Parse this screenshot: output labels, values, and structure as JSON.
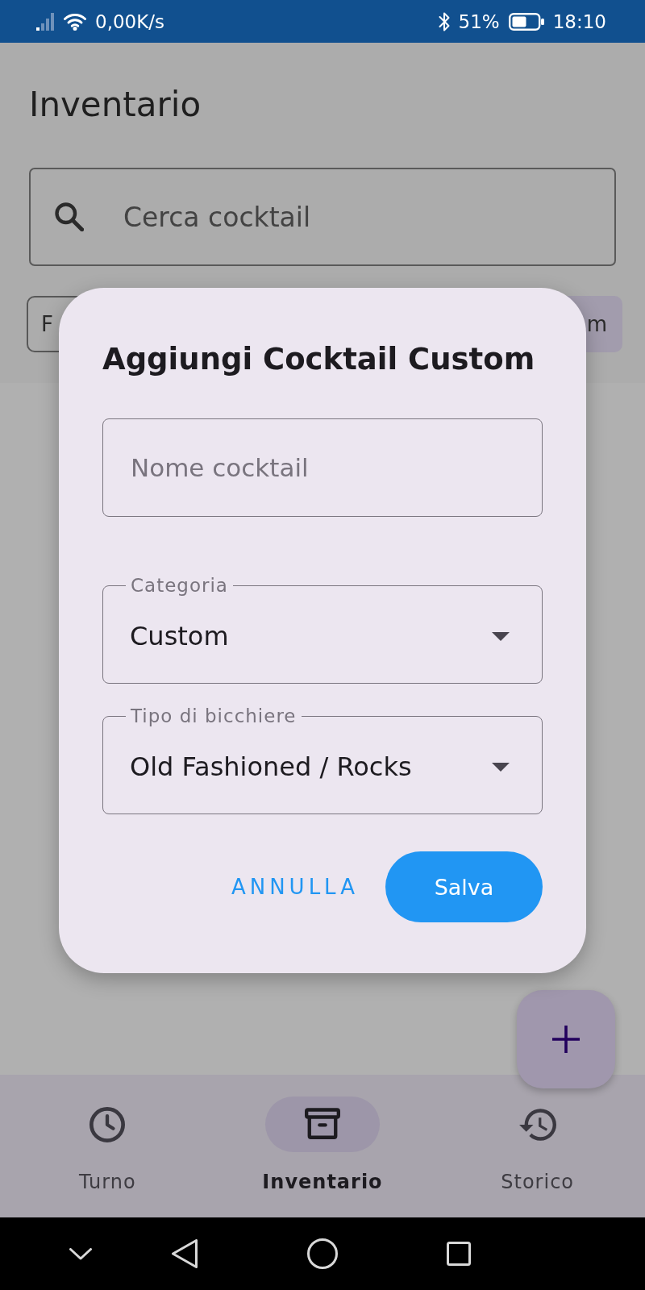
{
  "status_bar": {
    "network_speed": "0,00K/s",
    "battery": "51%",
    "time": "18:10"
  },
  "app_bar": {
    "title": "Inventario"
  },
  "search": {
    "placeholder": "Cerca cocktail"
  },
  "filter_chips": [
    {
      "label": "F",
      "selected": false
    },
    {
      "label": "m",
      "selected": true
    }
  ],
  "dialog": {
    "title": "Aggiungi Cocktail Custom",
    "fields": [
      {
        "kind": "text",
        "placeholder": "Nome cocktail"
      },
      {
        "kind": "dropdown",
        "label": "Categoria",
        "value": "Custom"
      },
      {
        "kind": "dropdown",
        "label": "Tipo di bicchiere",
        "value": "Old Fashioned / Rocks"
      }
    ],
    "buttons": [
      {
        "kind": "text",
        "label": "ANNULLA"
      },
      {
        "kind": "filled",
        "label": "Salva"
      }
    ]
  },
  "bottom_nav": [
    {
      "label": "Turno",
      "selected": false
    },
    {
      "label": "Inventario",
      "selected": true
    },
    {
      "label": "Storico",
      "selected": false
    }
  ]
}
